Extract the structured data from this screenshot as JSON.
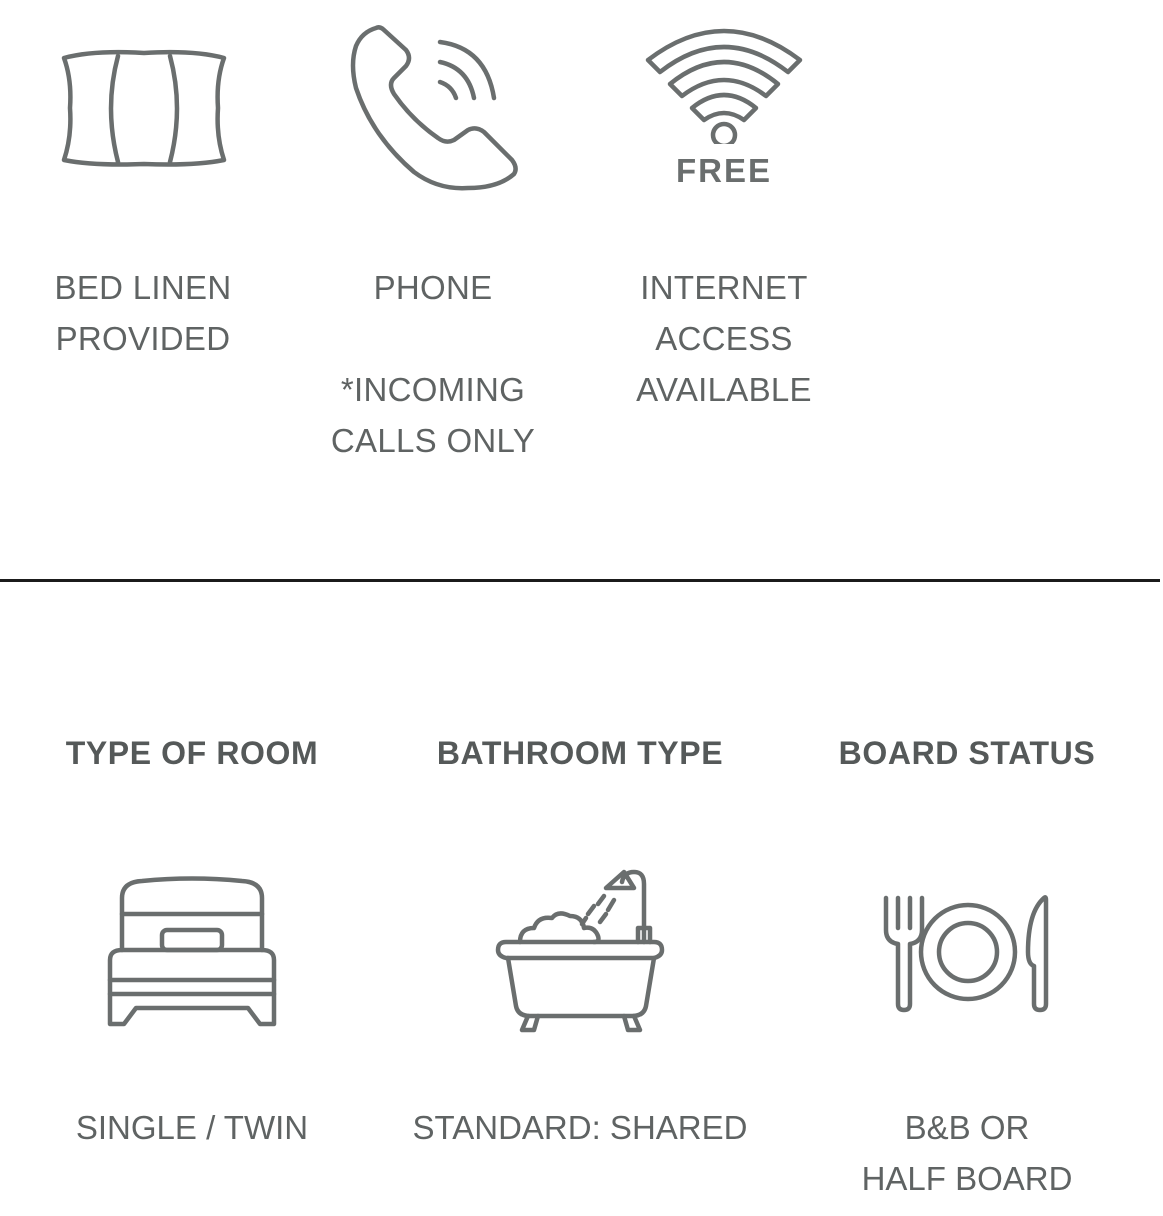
{
  "amenities": [
    {
      "icon": "pillow-icon",
      "label": "BED LINEN\nPROVIDED"
    },
    {
      "icon": "phone-icon",
      "label": "PHONE\n\n*INCOMING\nCALLS ONLY"
    },
    {
      "icon": "wifi-icon",
      "badge": "FREE",
      "label": "INTERNET\nACCESS\nAVAILABLE"
    }
  ],
  "details": [
    {
      "heading": "TYPE OF ROOM",
      "icon": "bed-icon",
      "value": "SINGLE / TWIN"
    },
    {
      "heading": "BATHROOM TYPE",
      "icon": "bathtub-icon",
      "value": "STANDARD: SHARED"
    },
    {
      "heading": "BOARD STATUS",
      "icon": "plate-cutlery-icon",
      "value": "B&B OR\nHALF BOARD"
    }
  ],
  "colors": {
    "icon_stroke": "#6a6e6e",
    "text": "#5f6363",
    "divider": "#1b1b1b"
  }
}
